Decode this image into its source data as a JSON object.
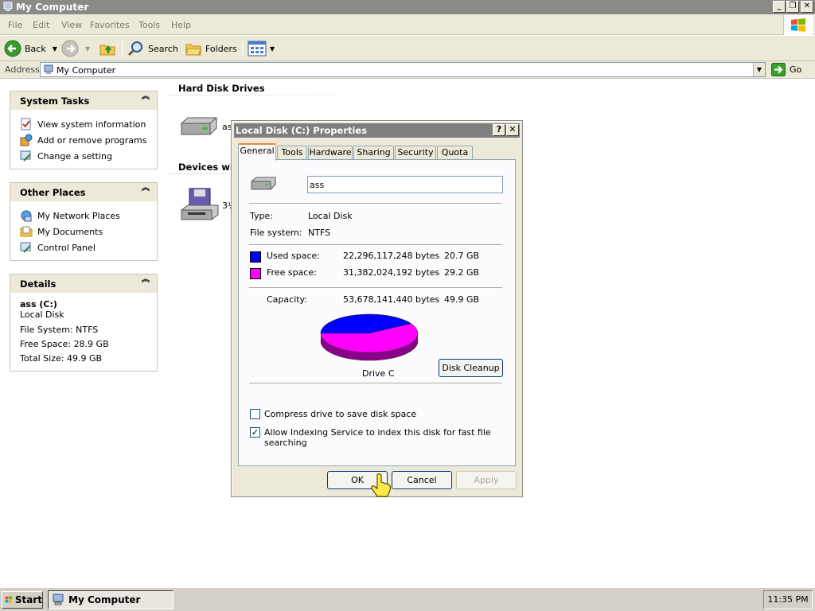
{
  "window": {
    "title": "My Computer"
  },
  "menu": [
    "File",
    "Edit",
    "View",
    "Favorites",
    "Tools",
    "Help"
  ],
  "toolbar": {
    "back": "Back",
    "search": "Search",
    "folders": "Folders"
  },
  "address": {
    "label": "Address",
    "value": "My Computer",
    "go": "Go"
  },
  "system_tasks": {
    "title": "System Tasks",
    "items": [
      "View system information",
      "Add or remove programs",
      "Change a setting"
    ]
  },
  "other_places": {
    "title": "Other Places",
    "items": [
      "My Network Places",
      "My Documents",
      "Control Panel"
    ]
  },
  "details": {
    "title": "Details",
    "name": "ass (C:)",
    "type": "Local Disk",
    "file_system": "File System: NTFS",
    "free_space": "Free Space: 28.9 GB",
    "total_size": "Total Size: 49.9 GB"
  },
  "content": {
    "hard_disk_header": "Hard Disk Drives",
    "devices_header": "Devices with",
    "drive_c_label": "as",
    "floppy_label": "3½"
  },
  "dialog": {
    "title": "Local Disk (C:) Properties",
    "tabs": [
      "General",
      "Tools",
      "Hardware",
      "Sharing",
      "Security",
      "Quota"
    ],
    "name_value": "ass",
    "type_label": "Type:",
    "type_value": "Local Disk",
    "fs_label": "File system:",
    "fs_value": "NTFS",
    "used_label": "Used space:",
    "used_bytes": "22,296,117,248 bytes",
    "used_gb": "20.7 GB",
    "free_label": "Free space:",
    "free_bytes": "31,382,024,192 bytes",
    "free_gb": "29.2 GB",
    "capacity_label": "Capacity:",
    "capacity_bytes": "53,678,141,440 bytes",
    "capacity_gb": "49.9 GB",
    "drive_caption": "Drive C",
    "cleanup": "Disk Cleanup",
    "compress_label": "Compress drive to save disk space",
    "compress_checked": false,
    "index_label": "Allow Indexing Service to index this disk for fast file searching",
    "index_checked": true,
    "ok": "OK",
    "cancel": "Cancel",
    "apply": "Apply",
    "colors": {
      "used": "#0000ff",
      "free": "#ff00ff"
    },
    "used_fraction": 0.415
  },
  "taskbar": {
    "start": "Start",
    "task": "My Computer",
    "clock": "11:35 PM"
  }
}
